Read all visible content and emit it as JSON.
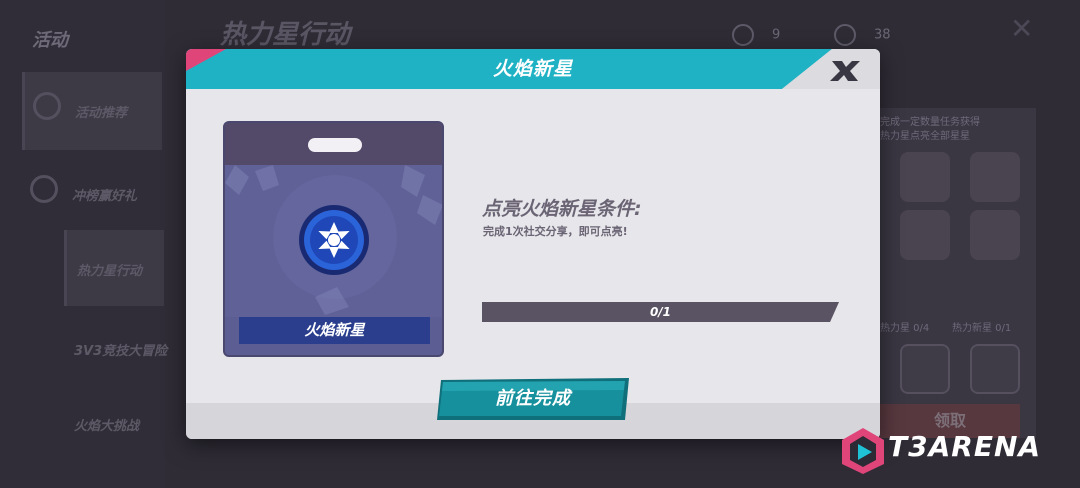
{
  "background": {
    "sidebar_title": "活动",
    "sidebar_items": [
      {
        "label": "活动推荐"
      },
      {
        "label": "冲榜赢好礼"
      },
      {
        "label": "热力星行动"
      },
      {
        "label": "3V3竞技大冒险"
      },
      {
        "label": "火焰大挑战"
      }
    ],
    "header_title": "热力星行动",
    "currency": [
      {
        "icon": "star-coin-icon",
        "value": "9"
      },
      {
        "icon": "gem-icon",
        "value": "38"
      }
    ],
    "right_panel_text": "完成一定数量任务获得热力星\n点亮全部星星赢好礼",
    "right_panel_stats": [
      "热力星 0/4",
      "热力新星 0/1"
    ],
    "right_panel_button": "领取"
  },
  "modal": {
    "title": "火焰新星",
    "item_name": "火焰新星",
    "condition_title": "点亮火焰新星条件:",
    "condition_desc": "完成1次社交分享，即可点亮!",
    "progress": {
      "current": 0,
      "total": 1,
      "text": "0/1"
    },
    "action_label": "前往完成"
  },
  "colors": {
    "header_teal": "#1fb2c4",
    "accent_pink": "#e0457a",
    "button_teal": "#16909c",
    "card_blue": "#5c5d93",
    "label_navy": "#2a3e8d",
    "progress_track": "#5a5363"
  },
  "watermark": {
    "text": "T3ARENA",
    "logo": "t3arena-logo-icon"
  }
}
